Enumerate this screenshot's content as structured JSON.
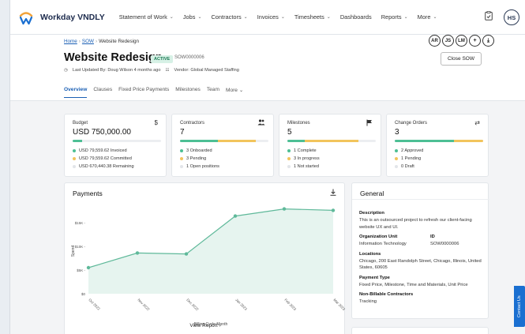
{
  "app": {
    "brand": "Workday VNDLY",
    "avatar": "HS"
  },
  "nav": [
    {
      "label": "Statement of Work",
      "chevron": true
    },
    {
      "label": "Jobs",
      "chevron": true
    },
    {
      "label": "Contractors",
      "chevron": true
    },
    {
      "label": "Invoices",
      "chevron": true
    },
    {
      "label": "Timesheets",
      "chevron": true
    },
    {
      "label": "Dashboards",
      "chevron": false
    },
    {
      "label": "Reports",
      "chevron": true
    },
    {
      "label": "More",
      "chevron": true
    }
  ],
  "breadcrumb": {
    "home": "Home",
    "sow": "SOW",
    "current": "Website Redesign"
  },
  "page": {
    "title": "Website Redesign",
    "status": "ACTIVE",
    "sow_id": "SOW0000006",
    "updated": "Last Updated By: Doug Wilson 4 months ago",
    "vendor": "Vendor: Global Managed Staffing",
    "close_label": "Close SOW",
    "team_avatars": [
      "AR",
      "JS",
      "LM"
    ]
  },
  "tabs": [
    "Overview",
    "Clauses",
    "Fixed Price Payments",
    "Milestones",
    "Team",
    "More"
  ],
  "stats": {
    "budget": {
      "label": "Budget",
      "value": "USD 750,000.00",
      "items": [
        "USD 79,559.62 Invoiced",
        "USD 79,559.62 Committed",
        "USD 670,440.38 Remaining"
      ]
    },
    "contractors": {
      "label": "Contractors",
      "value": "7",
      "items": [
        "3 Onboarded",
        "3 Pending",
        "1 Open positions"
      ]
    },
    "milestones": {
      "label": "Milestones",
      "value": "5",
      "items": [
        "1 Complete",
        "3 In progress",
        "1 Not started"
      ]
    },
    "change_orders": {
      "label": "Change Orders",
      "value": "3",
      "items": [
        "2 Approved",
        "1 Pending",
        "0 Draft"
      ]
    }
  },
  "payments": {
    "title": "Payments",
    "view_report": "View Report",
    "xlabel": "Billing Cycle Month",
    "ylabel": "Spend"
  },
  "chart_data": {
    "type": "area",
    "title": "",
    "xlabel": "Billing Cycle Month",
    "ylabel": "Spend",
    "categories": [
      "Oct 2022",
      "Nov 2022",
      "Dec 2022",
      "Jan 2023",
      "Feb 2023",
      "Mar 2023"
    ],
    "yticks": [
      "$0",
      "$5K",
      "$10K",
      "$15K"
    ],
    "ylim": [
      0,
      18000
    ],
    "values": [
      5500,
      8600,
      8400,
      16400,
      17900,
      17600
    ]
  },
  "general": {
    "title": "General",
    "description_label": "Description",
    "description": "This is an outsourced project to refresh our client-facing website UX and UI.",
    "org_label": "Organization Unit",
    "org": "Information Technology",
    "id_label": "ID",
    "id": "SOW0000006",
    "locations_label": "Locations",
    "locations": "Chicago, 200 East Randolph Street, Chicago, Illinois, United States, 60605",
    "payment_type_label": "Payment Type",
    "payment_type": "Fixed Price, Milestone, Time and Materials, Unit Price",
    "nonbillable_label": "Non-Billable Contractors",
    "nonbillable": "Tracking"
  },
  "contact_us": "Contact Us",
  "colors": {
    "green": "#4dbf94",
    "amber": "#f2c45c",
    "grey": "#e2e5e9",
    "accent": "#1a5fb4",
    "area": "#e6f4ef",
    "line": "#5fb99a"
  }
}
